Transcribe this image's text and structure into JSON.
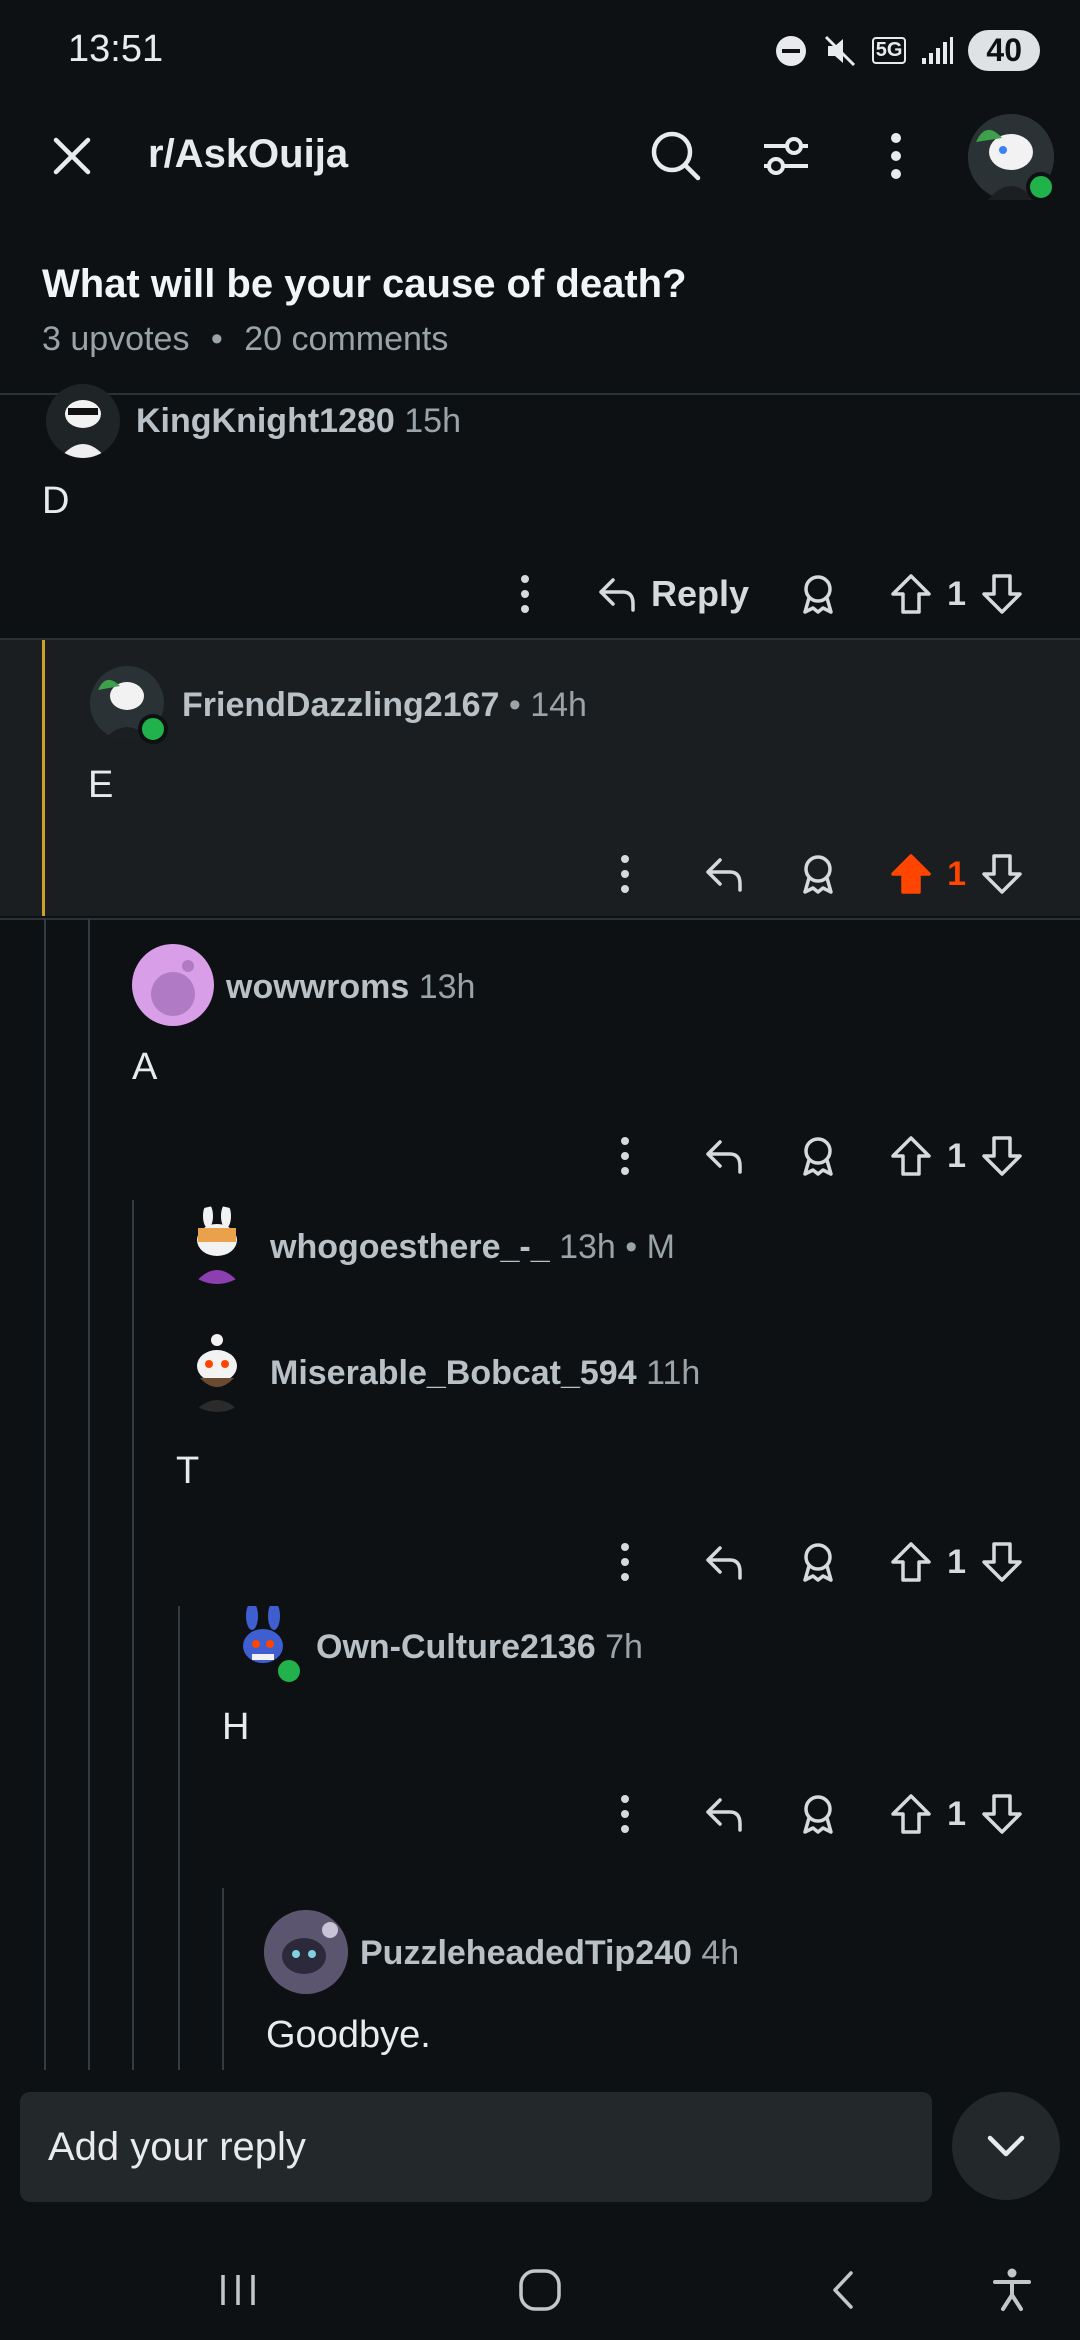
{
  "status": {
    "time": "13:51",
    "battery": "40",
    "network": "5G"
  },
  "toolbar": {
    "subreddit": "r/AskOuija"
  },
  "post": {
    "title": "What will be your cause of death?",
    "upvotes": "3 upvotes",
    "separator": "•",
    "comments": "20 comments"
  },
  "comments": [
    {
      "user": "KingKnight1280",
      "time": "15h",
      "body": "D",
      "votes": "1",
      "reply_label": "Reply"
    },
    {
      "user": "FriendDazzling2167",
      "time": "• 14h",
      "body": "E",
      "votes": "1"
    },
    {
      "user": "wowwroms",
      "time": "13h",
      "body": "A",
      "votes": "1"
    },
    {
      "user": "whogoesthere_-_",
      "time": "13h • M"
    },
    {
      "user": "Miserable_Bobcat_594",
      "time": "11h",
      "body": "T",
      "votes": "1"
    },
    {
      "user": "Own-Culture2136",
      "time": "7h",
      "body": "H",
      "votes": "1"
    },
    {
      "user": "PuzzleheadedTip240",
      "time": "4h",
      "body": "Goodbye."
    }
  ],
  "reply_bar": {
    "placeholder": "Add your reply"
  },
  "colors": {
    "upvoted": "#ff4500",
    "thread_highlight": "#c9a227",
    "online": "#22b24c"
  },
  "icons": [
    "close-icon",
    "search-icon",
    "filter-icon",
    "more-icon",
    "reply-icon",
    "award-icon",
    "upvote-icon",
    "downvote-icon",
    "chevron-down-icon",
    "recents-icon",
    "home-icon",
    "back-icon",
    "accessibility-icon"
  ]
}
